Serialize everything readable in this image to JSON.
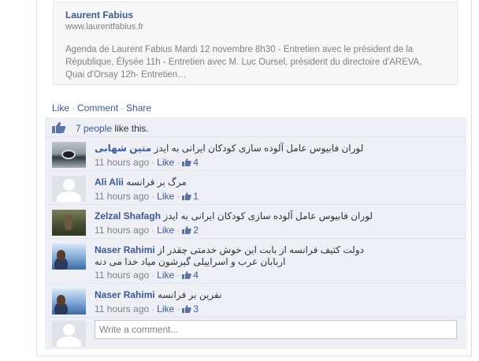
{
  "preview": {
    "title": "Laurent Fabius",
    "url": "www.laurentfabius.fr",
    "description": "Agenda de Laurent Fabius Mardi 12 novembre 8h30 - Entretien avec le président de la République, Élysée 11h - Entretien avec M. Luc Oursel, président du directoire d'AREVA, Quai d'Orsay 12h- Entretien…"
  },
  "actions": {
    "like": "Like",
    "comment": "Comment",
    "share": "Share"
  },
  "likes": {
    "people": "7 people",
    "suffix": "like this."
  },
  "comments": [
    {
      "name": "متین شهابی",
      "text": "لوران فابیوس عامل آلوده سازی کودکان ایرانی به ایدز",
      "time": "11 hours ago",
      "like": "Like",
      "likes": "4"
    },
    {
      "name": "Ali Alii",
      "text": "مرگ بر فرانسه",
      "time": "11 hours ago",
      "like": "Like",
      "likes": "1"
    },
    {
      "name": "Zelzal Shafagh",
      "text": "لوران فابیوس عامل آلوده سازی کودکان ایرانی به ایدز",
      "time": "11 hours ago",
      "like": "Like",
      "likes": "2"
    },
    {
      "name": "Naser Rahimi",
      "text": "دولت کثیف فرانسه از بابت این خوش خدمتی چقدر از",
      "text2": "اربابان عرب و اسراییلی گیرشون میاد خدا می دنه",
      "time": "11 hours ago",
      "like": "Like",
      "likes": "4"
    },
    {
      "name": "Naser Rahimi",
      "text": "نفرین بر فرانسه",
      "time": "11 hours ago",
      "like": "Like",
      "likes": "3"
    }
  ],
  "write_placeholder": "Write a comment...",
  "colors": {
    "link": "#3b5998",
    "ufi_bg": "#edeff4",
    "muted": "#808080"
  }
}
